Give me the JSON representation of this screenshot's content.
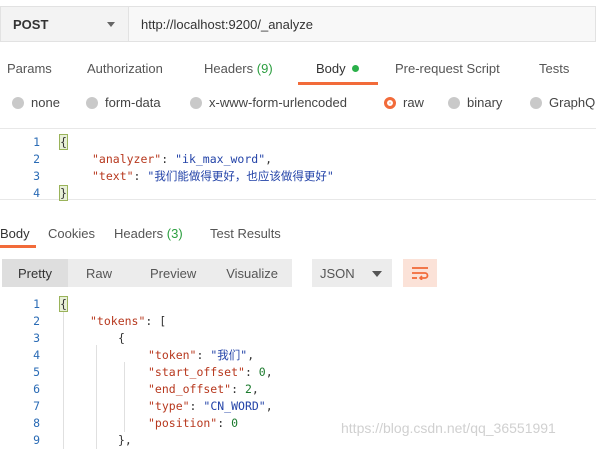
{
  "request": {
    "method": "POST",
    "url": "http://localhost:9200/_analyze"
  },
  "request_tabs": [
    {
      "label": "Params"
    },
    {
      "label": "Authorization"
    },
    {
      "label": "Headers",
      "count": "(9)"
    },
    {
      "label": "Body"
    },
    {
      "label": "Pre-request Script"
    },
    {
      "label": "Tests"
    }
  ],
  "body_types": [
    "none",
    "form-data",
    "x-www-form-urlencoded",
    "raw",
    "binary",
    "GraphQ"
  ],
  "request_body": {
    "line_numbers": [
      "1",
      "2",
      "3",
      "4"
    ],
    "open_brace": "{",
    "close_brace": "}",
    "key1": "\"analyzer\"",
    "val1": "\"ik_max_word\"",
    "key2": "\"text\"",
    "val2": "\"我们能做得更好，也应该做得更好\""
  },
  "response_tabs": [
    {
      "label": "Body"
    },
    {
      "label": "Cookies"
    },
    {
      "label": "Headers",
      "count": "(3)"
    },
    {
      "label": "Test Results"
    }
  ],
  "view_modes": [
    "Pretty",
    "Raw",
    "Preview",
    "Visualize"
  ],
  "format": "JSON",
  "response_body": {
    "line_numbers": [
      "1",
      "2",
      "3",
      "4",
      "5",
      "6",
      "7",
      "8",
      "9"
    ],
    "open_brace": "{",
    "tokens_key": "\"tokens\"",
    "open_bracket": "[",
    "obj_open": "{",
    "token_key": "\"token\"",
    "token_val": "\"我们\"",
    "start_key": "\"start_offset\"",
    "start_val": "0",
    "end_key": "\"end_offset\"",
    "end_val": "2",
    "type_key": "\"type\"",
    "type_val": "\"CN_WORD\"",
    "position_key": "\"position\"",
    "position_val": "0",
    "obj_close": "},"
  },
  "watermark": "https://blog.csdn.net/qq_36551991",
  "colors": {
    "accent": "#f26b3a",
    "green": "#2b9e3f",
    "json_key": "#b7381e",
    "json_string": "#2343a8",
    "json_number": "#1b7a2d"
  }
}
